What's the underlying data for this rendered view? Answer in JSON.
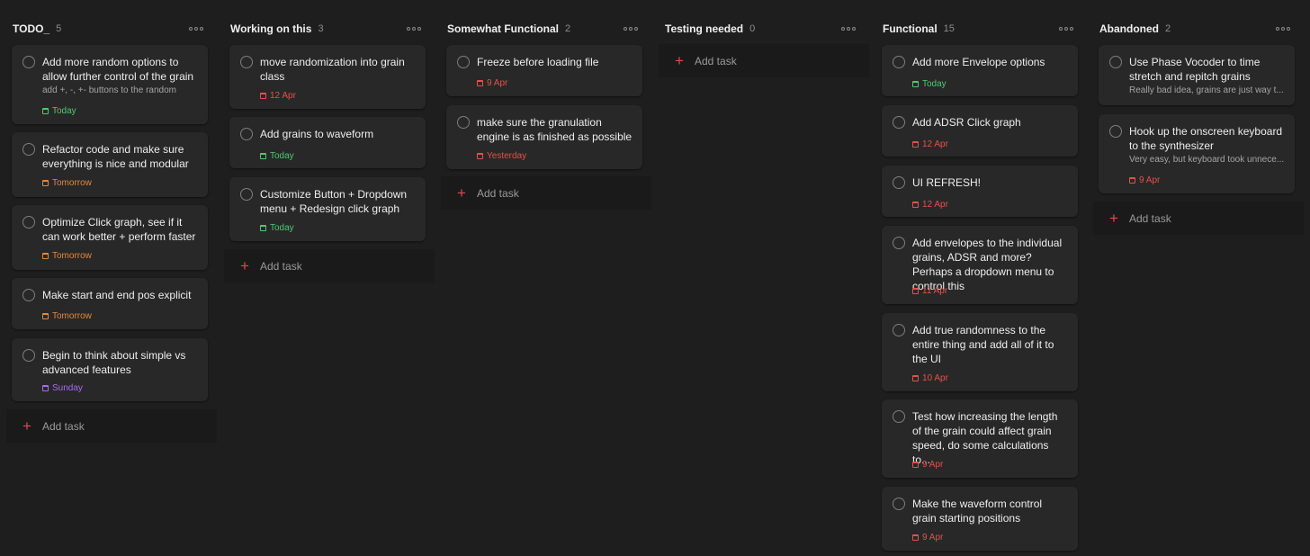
{
  "colors": {
    "background": "#1e1e1e",
    "card": "#282828",
    "add_task_plus": "#de4c4a",
    "due_today": "#4ec971",
    "due_tomorrow": "#e3883c",
    "due_overdue": "#e4514a",
    "due_sunday": "#a56cf2"
  },
  "icons": {
    "complete": "circle-icon",
    "due": "calendar-icon",
    "more": "more-icon",
    "add": "plus-icon"
  },
  "columns": [
    {
      "title": "TODO_",
      "count": "5",
      "add_task": "Add task",
      "cards": [
        {
          "title": "Add more random options to allow further control of the grain",
          "desc": "add +, -, +- buttons to the random",
          "due": "Today",
          "due_color": "#4ec971"
        },
        {
          "title": "Refactor code and make sure everything is nice and modular",
          "due": "Tomorrow",
          "due_color": "#e3883c"
        },
        {
          "title": "Optimize Click graph, see if it can work better + perform faster",
          "due": "Tomorrow",
          "due_color": "#e3883c"
        },
        {
          "title": "Make start and end pos explicit",
          "due": "Tomorrow",
          "due_color": "#e3883c"
        },
        {
          "title": "Begin to think about simple vs advanced features",
          "due": "Sunday",
          "due_color": "#a56cf2"
        }
      ]
    },
    {
      "title": "Working on this",
      "count": "3",
      "add_task": "Add task",
      "cards": [
        {
          "title": "move randomization into grain class",
          "due": "12 Apr",
          "due_color": "#e4514a"
        },
        {
          "title": "Add grains to waveform",
          "due": "Today",
          "due_color": "#4ec971"
        },
        {
          "title": "Customize Button + Dropdown menu + Redesign click graph",
          "due": "Today",
          "due_color": "#4ec971"
        }
      ]
    },
    {
      "title": "Somewhat Functional",
      "count": "2",
      "add_task": "Add task",
      "cards": [
        {
          "title": "Freeze before loading file",
          "due": "9 Apr",
          "due_color": "#e4514a"
        },
        {
          "title": "make sure the granulation engine is as finished as possible",
          "due": "Yesterday",
          "due_color": "#e4514a"
        }
      ]
    },
    {
      "title": "Testing needed",
      "count": "0",
      "add_task": "Add task",
      "cards": []
    },
    {
      "title": "Functional",
      "count": "15",
      "add_task": "Add task",
      "cards": [
        {
          "title": "Add more Envelope options",
          "due": "Today",
          "due_color": "#4ec971"
        },
        {
          "title": "Add ADSR Click graph",
          "due": "12 Apr",
          "due_color": "#e4514a"
        },
        {
          "title": "UI REFRESH!",
          "due": "12 Apr",
          "due_color": "#e4514a"
        },
        {
          "title": "Add envelopes to the individual grains, ADSR and more? Perhaps a dropdown menu to control this",
          "due": "11 Apr",
          "due_color": "#e4514a"
        },
        {
          "title": "Add true randomness to the entire thing and add all of it to the UI",
          "due": "10 Apr",
          "due_color": "#e4514a"
        },
        {
          "title": "Test how increasing the length of the grain could affect grain speed, do some calculations to...",
          "due": "9 Apr",
          "due_color": "#e4514a"
        },
        {
          "title": "Make the waveform control grain starting positions",
          "due": "9 Apr",
          "due_color": "#e4514a"
        }
      ]
    },
    {
      "title": "Abandoned",
      "count": "2",
      "add_task": "Add task",
      "cards": [
        {
          "title": "Use Phase Vocoder to time stretch and repitch grains",
          "desc": "Really bad idea, grains are just way t...",
          "due_color": "#e4514a"
        },
        {
          "title": "Hook up the onscreen keyboard to the synthesizer",
          "desc": "Very easy, but keyboard took unnece...",
          "due": "9 Apr",
          "due_color": "#e4514a"
        }
      ]
    }
  ]
}
